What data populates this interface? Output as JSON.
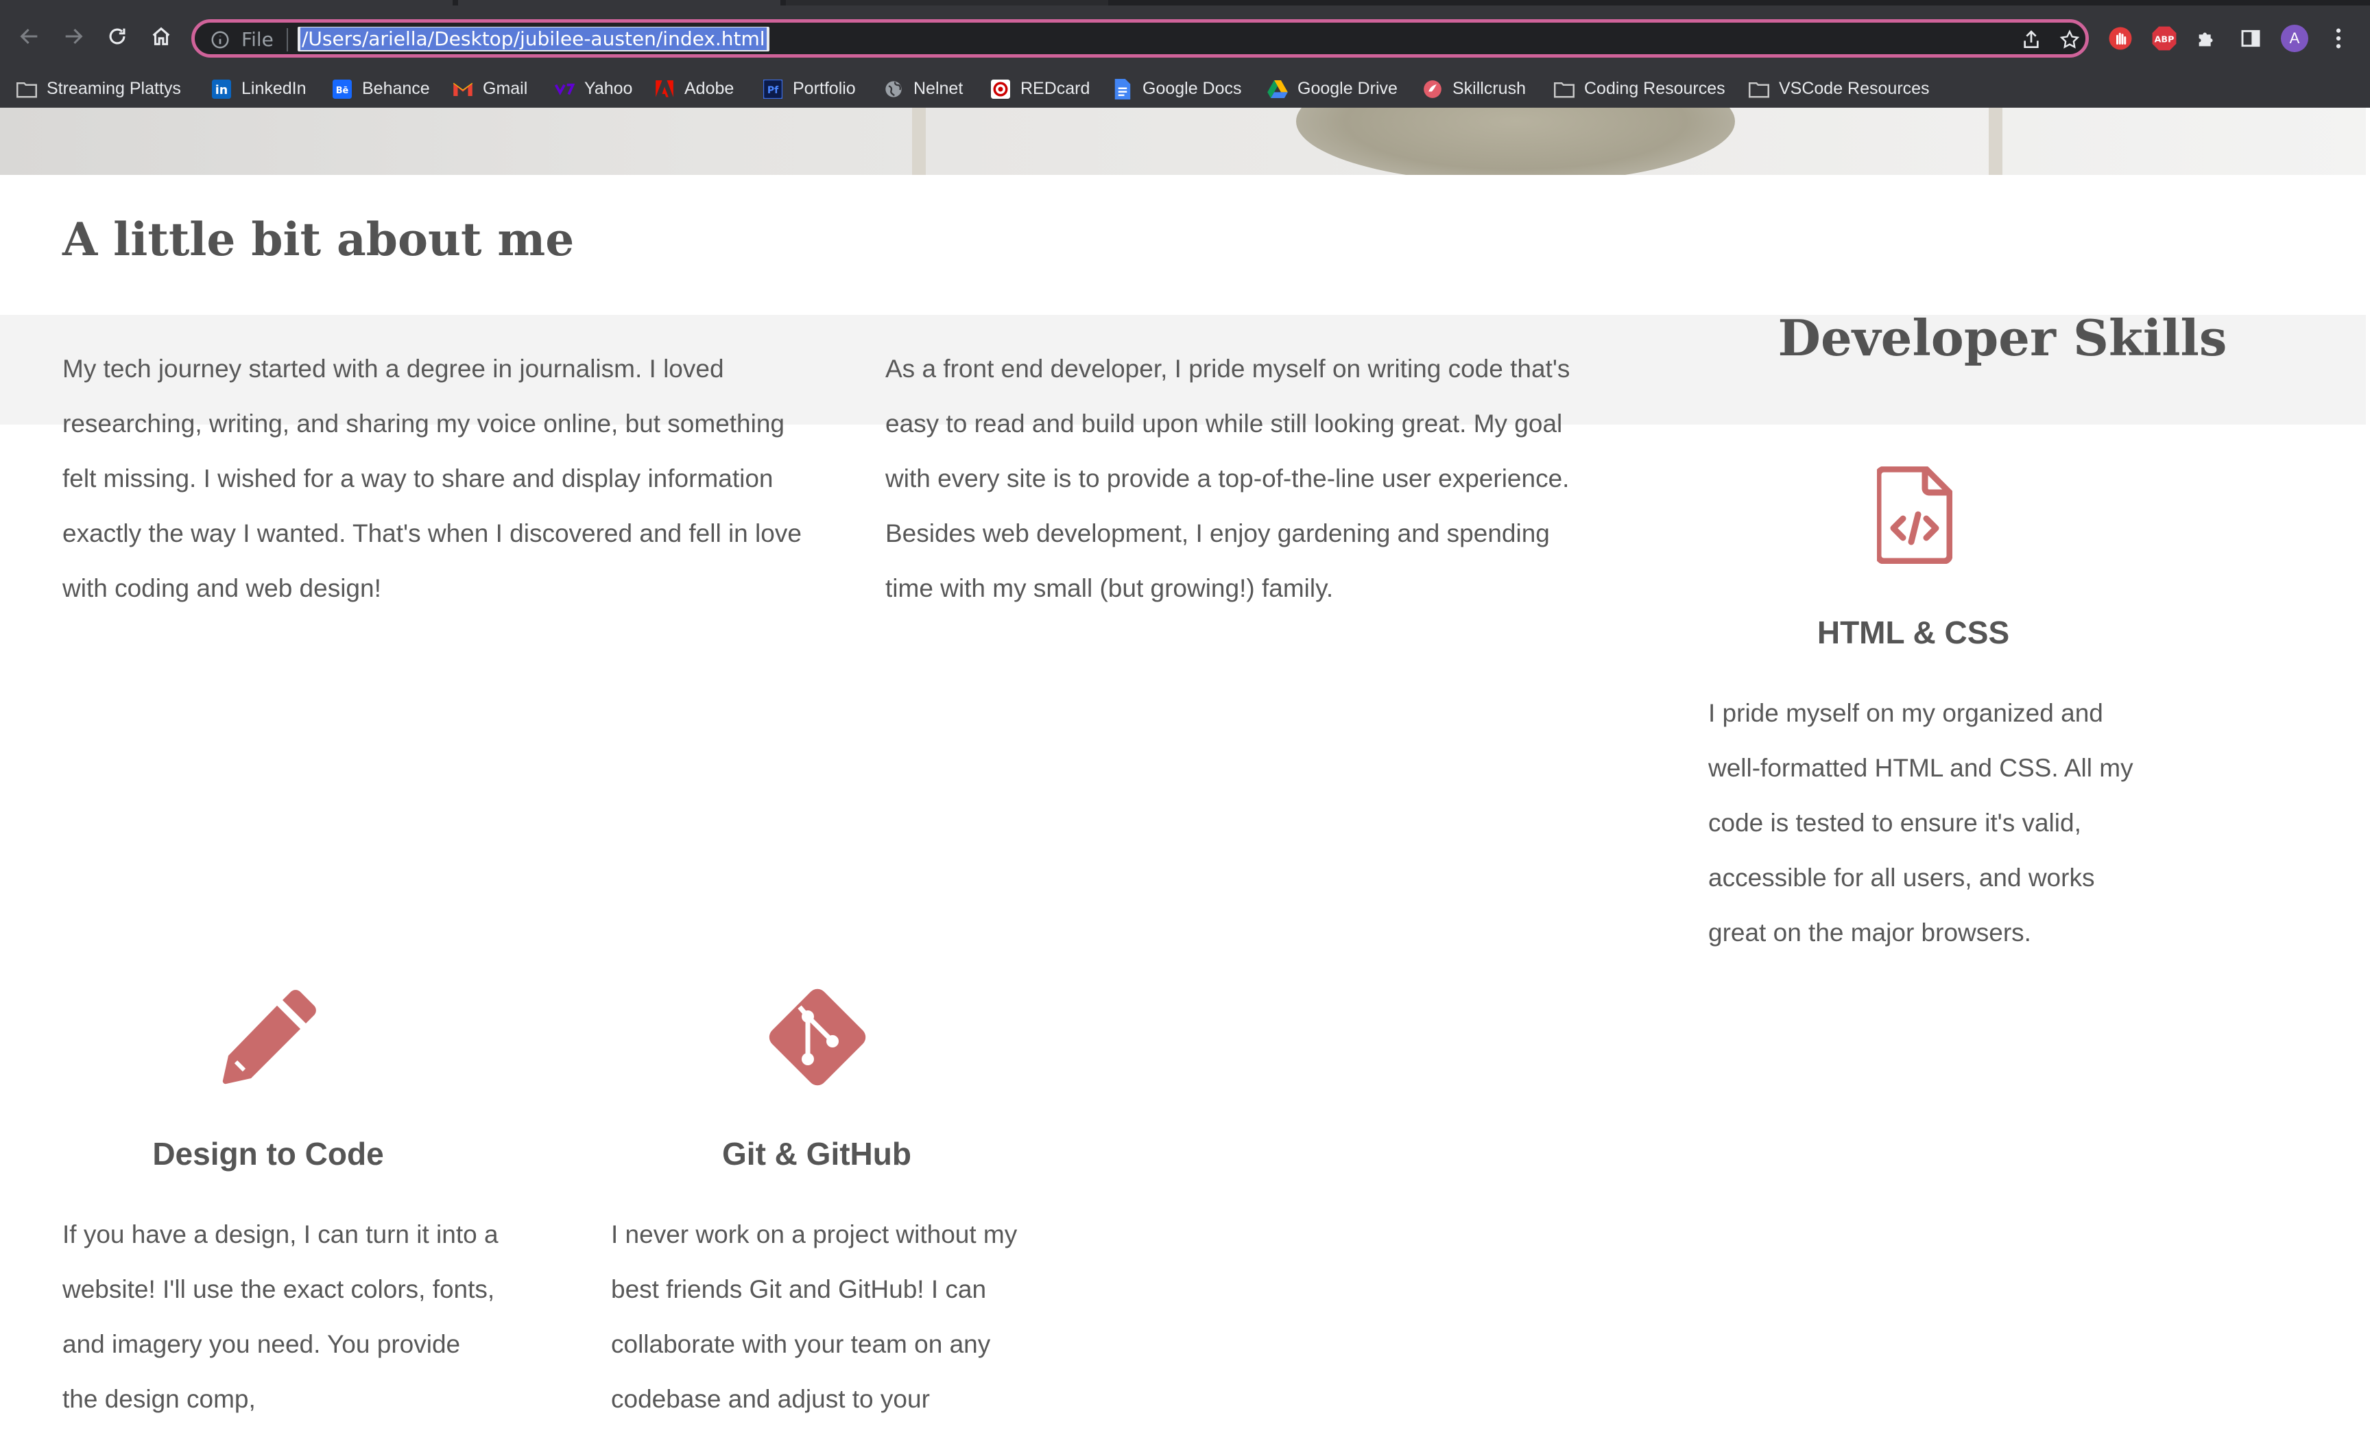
{
  "browser": {
    "scheme_label": "File",
    "url": "/Users/ariella/Desktop/jubilee-austen/index.html",
    "profile_initial": "A",
    "extensions": [
      "Web Clipper",
      "ABP"
    ],
    "omnibox_border_color": "#d0639a"
  },
  "bookmarks": [
    {
      "label": "Streaming Plattys",
      "icon": "folder-icon"
    },
    {
      "label": "LinkedIn",
      "icon": "linkedin-icon"
    },
    {
      "label": "Behance",
      "icon": "behance-icon"
    },
    {
      "label": "Gmail",
      "icon": "gmail-icon"
    },
    {
      "label": "Yahoo",
      "icon": "yahoo-icon"
    },
    {
      "label": "Adobe",
      "icon": "adobe-icon"
    },
    {
      "label": "Portfolio",
      "icon": "portfolio-icon"
    },
    {
      "label": "Nelnet",
      "icon": "globe-icon"
    },
    {
      "label": "REDcard",
      "icon": "target-icon"
    },
    {
      "label": "Google Docs",
      "icon": "google-docs-icon"
    },
    {
      "label": "Google Drive",
      "icon": "google-drive-icon"
    },
    {
      "label": "Skillcrush",
      "icon": "skillcrush-icon"
    },
    {
      "label": "Coding Resources",
      "icon": "folder-icon"
    },
    {
      "label": "VSCode Resources",
      "icon": "folder-icon"
    }
  ],
  "about": {
    "title": "A little bit about me",
    "paragraph1": "My tech journey started with a degree in journalism. I loved researching, writing, and sharing my voice online, but something felt missing. I wished for a way to share and display information exactly the way I wanted. That's when I discovered and fell in love with coding and web design!",
    "paragraph2": "As a front end developer, I pride myself on writing code that's easy to read and build upon while still looking great. My goal with every site is to provide a top-of-the-line user experience. Besides web development, I enjoy gardening and spending time with my small (but growing!) family."
  },
  "skills": {
    "title": "Developer Skills",
    "accent_color": "#c96b6b",
    "items": [
      {
        "title": "HTML & CSS",
        "icon": "file-code-icon",
        "description": "I pride myself on my organized and well-formatted HTML and CSS. All my code is tested to ensure it's valid, accessible for all users, and works great on the major browsers."
      },
      {
        "title": "Design to Code",
        "icon": "pencil-icon",
        "description": "If you have a design, I can turn it into a website! I'll use the exact colors, fonts, and imagery you need. You provide the design comp,"
      },
      {
        "title": "Git & GitHub",
        "icon": "git-icon",
        "description": "I never work on a project without my best friends Git and GitHub! I can collaborate with your team on any codebase and adjust to your"
      }
    ]
  }
}
